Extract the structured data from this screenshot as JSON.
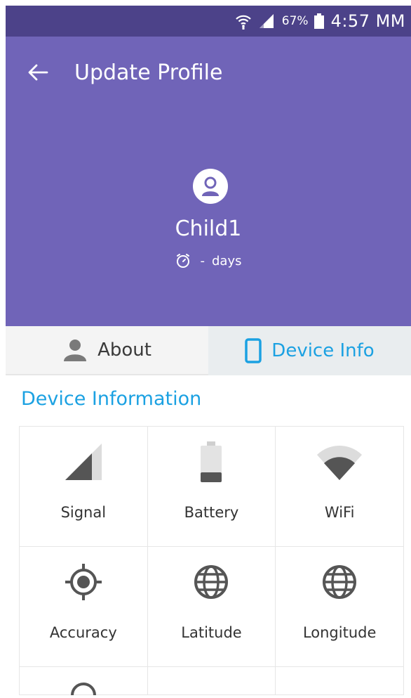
{
  "status_bar": {
    "battery_percent": "67%",
    "time": "4:57 MM",
    "icons": [
      "wifi-icon",
      "signal-icon",
      "battery-icon"
    ]
  },
  "header": {
    "title": "Update Profile",
    "back_icon": "arrow-left-icon",
    "child_name": "Child1",
    "days_value": "-",
    "days_unit": "days"
  },
  "tabs": [
    {
      "label": "About",
      "icon": "person-icon",
      "active": false
    },
    {
      "label": "Device Info",
      "icon": "phone-icon",
      "active": true
    }
  ],
  "section_title": "Device Information",
  "device_items": [
    {
      "label": "Signal",
      "icon": "signal-strength-icon"
    },
    {
      "label": "Battery",
      "icon": "battery-level-icon"
    },
    {
      "label": "WiFi",
      "icon": "wifi-strength-icon"
    },
    {
      "label": "Accuracy",
      "icon": "target-icon"
    },
    {
      "label": "Latitude",
      "icon": "globe-icon"
    },
    {
      "label": "Longitude",
      "icon": "globe-icon"
    }
  ],
  "colors": {
    "header": "#7064b8",
    "status_bar": "#4c4289",
    "accent": "#1ba1e2",
    "icon_gray": "#555555"
  }
}
